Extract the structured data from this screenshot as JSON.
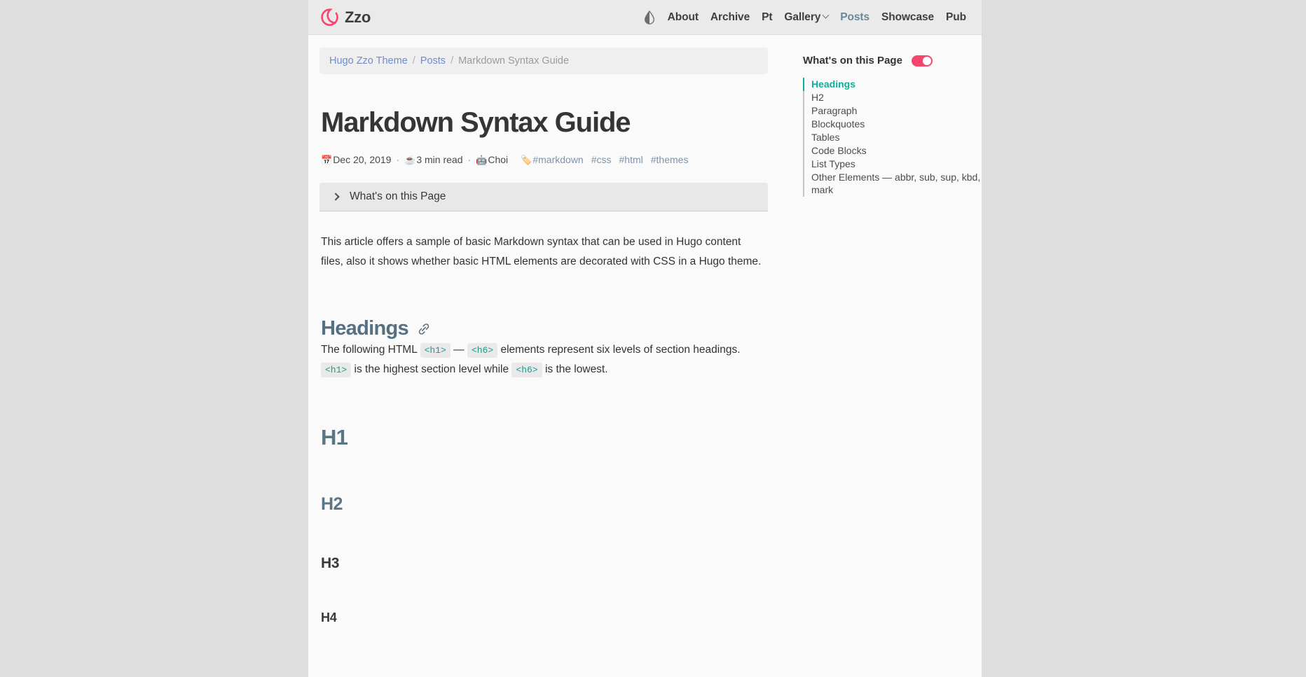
{
  "site": {
    "logo_icon": "enso-ring-icon",
    "brand": "Zzo",
    "brand_color": "#f8456b"
  },
  "navbar": {
    "theme_toggle_icon": "contrast-droplet-icon",
    "links": [
      {
        "label": "About",
        "active": false
      },
      {
        "label": "Archive",
        "active": false
      },
      {
        "label": "Pt",
        "active": false
      },
      {
        "label": "Gallery",
        "active": false,
        "has_caret": true
      },
      {
        "label": "Posts",
        "active": true
      },
      {
        "label": "Showcase",
        "active": false
      },
      {
        "label": "Pub",
        "active": false
      }
    ],
    "active_color": "#6b8899"
  },
  "breadcrumb": {
    "items": [
      {
        "label": "Hugo Zzo Theme",
        "link": true
      },
      {
        "label": "Posts",
        "link": true
      },
      {
        "label": "Markdown Syntax Guide",
        "link": false
      }
    ],
    "separator": "/",
    "link_color": "#6f8ccb"
  },
  "post": {
    "title": "Markdown Syntax Guide",
    "meta": {
      "date_icon": "calendar-icon",
      "date": "Dec 20, 2019",
      "readtime_icon": "coffee-icon",
      "readtime": "3 min read",
      "author_icon": "robot-icon",
      "author": "Choi",
      "separator": "·",
      "tags_icon": "tag-icon",
      "tags": [
        "#markdown",
        "#css",
        "#html",
        "#themes"
      ],
      "tag_color": "#7f93a8"
    },
    "toc_details_label": "What's on this Page",
    "toc_details_icon": "chevron-right-icon",
    "intro": "This article offers a sample of basic Markdown syntax that can be used in Hugo content files, also it shows whether basic HTML elements are decorated with CSS in a Hugo theme.",
    "sections": {
      "headings": {
        "title": "Headings",
        "anchor_icon": "link-chain-icon",
        "body_1": "The following HTML",
        "code_1": "<h1>",
        "dash": "—",
        "code_2": "<h6>",
        "body_2": "elements represent six levels of section headings.",
        "code_3": "<h1>",
        "body_3": "is the highest section level while",
        "code_4": "<h6>",
        "body_4": "is the lowest.",
        "demo_h1": "H1",
        "demo_h2": "H2",
        "demo_h3": "H3",
        "demo_h4": "H4",
        "heading_color": "#557081",
        "code_color": "#1a9c8c"
      }
    }
  },
  "sidebar": {
    "title": "What's on this Page",
    "toggle_on": true,
    "toggle_color": "#f8456b",
    "active_color": "#0fae99",
    "items": [
      {
        "label": "Headings",
        "active": true
      },
      {
        "label": "H2",
        "active": false
      },
      {
        "label": "Paragraph",
        "active": false
      },
      {
        "label": "Blockquotes",
        "active": false
      },
      {
        "label": "Tables",
        "active": false
      },
      {
        "label": "Code Blocks",
        "active": false
      },
      {
        "label": "List Types",
        "active": false
      },
      {
        "label": "Other Elements — abbr, sub, sup, kbd, mark",
        "active": false
      }
    ]
  }
}
